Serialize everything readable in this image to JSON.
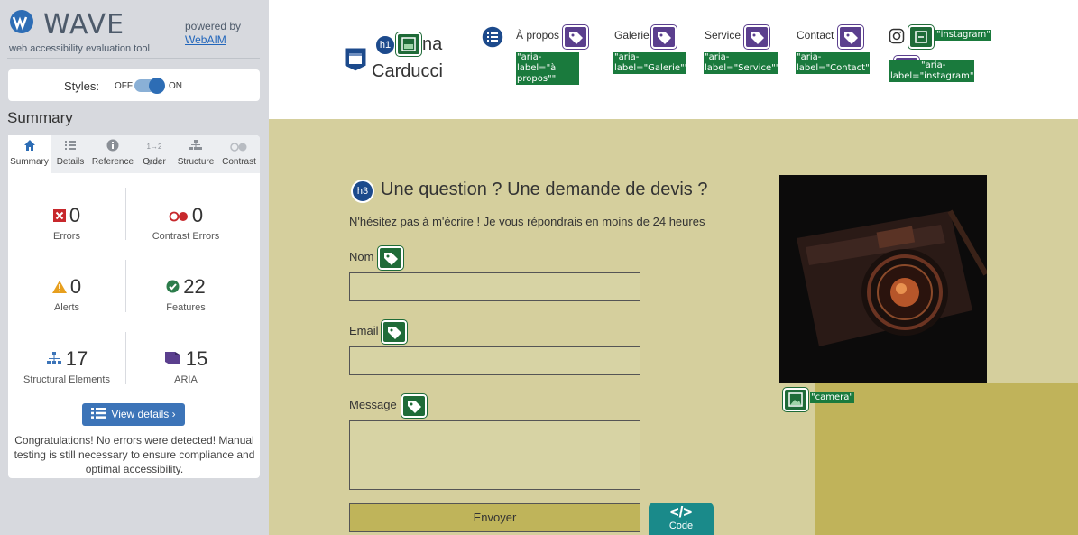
{
  "sidebar": {
    "logo_text": "WAVE",
    "tagline": "web accessibility evaluation tool",
    "powered_by": "powered by",
    "powered_link": "WebAIM",
    "styles_label": "Styles:",
    "styles_off": "OFF",
    "styles_on": "ON",
    "summary_title": "Summary",
    "tabs": [
      {
        "label": "Summary",
        "icon": "home-icon"
      },
      {
        "label": "Details",
        "icon": "list-icon"
      },
      {
        "label": "Reference",
        "icon": "info-icon"
      },
      {
        "label": "Order",
        "icon": "order-icon"
      },
      {
        "label": "Structure",
        "icon": "structure-icon"
      },
      {
        "label": "Contrast",
        "icon": "contrast-icon"
      }
    ],
    "stats": {
      "errors": {
        "value": "0",
        "label": "Errors"
      },
      "contrast_errors": {
        "value": "0",
        "label": "Contrast Errors"
      },
      "alerts": {
        "value": "0",
        "label": "Alerts"
      },
      "features": {
        "value": "22",
        "label": "Features"
      },
      "structural": {
        "value": "17",
        "label": "Structural Elements"
      },
      "aria": {
        "value": "15",
        "label": "ARIA"
      }
    },
    "view_details": "View details ›",
    "congrats": "Congratulations! No errors were detected! Manual testing is still necessary to ensure compliance and optimal accessibility."
  },
  "page": {
    "logo_text_1": "na",
    "logo_text_2": "Carducci",
    "h1_badge": "h1",
    "nav": [
      {
        "label": "À propos",
        "aria": "\"aria-label=\"à propos\"\""
      },
      {
        "label": "Galerie",
        "aria": "\"aria-label=\"Galerie\"\""
      },
      {
        "label": "Service",
        "aria": "\"aria-label=\"Service\"\""
      },
      {
        "label": "Contact",
        "aria": "\"aria-label=\"Contact\"\""
      }
    ],
    "instagram_alt": "\"instagram\"",
    "instagram_aria": "\"aria-label=\"instagram\"\"",
    "h3_badge": "h3",
    "heading": "Une question ? Une demande de devis ?",
    "subtext": "N'hésitez pas à m'écrire ! Je vous répondrais en moins de 24 heures",
    "label_nom": "Nom",
    "label_email": "Email",
    "label_message": "Message",
    "send_button": "Envoyer",
    "camera_alt": "\"camera\"",
    "code_label": "Code"
  },
  "colors": {
    "wave_blue": "#2d6db5",
    "feature_green": "#1f6b38",
    "aria_purple": "#5b3f8e",
    "content_bg": "#d5cf9d",
    "olive": "#c0b35a"
  }
}
